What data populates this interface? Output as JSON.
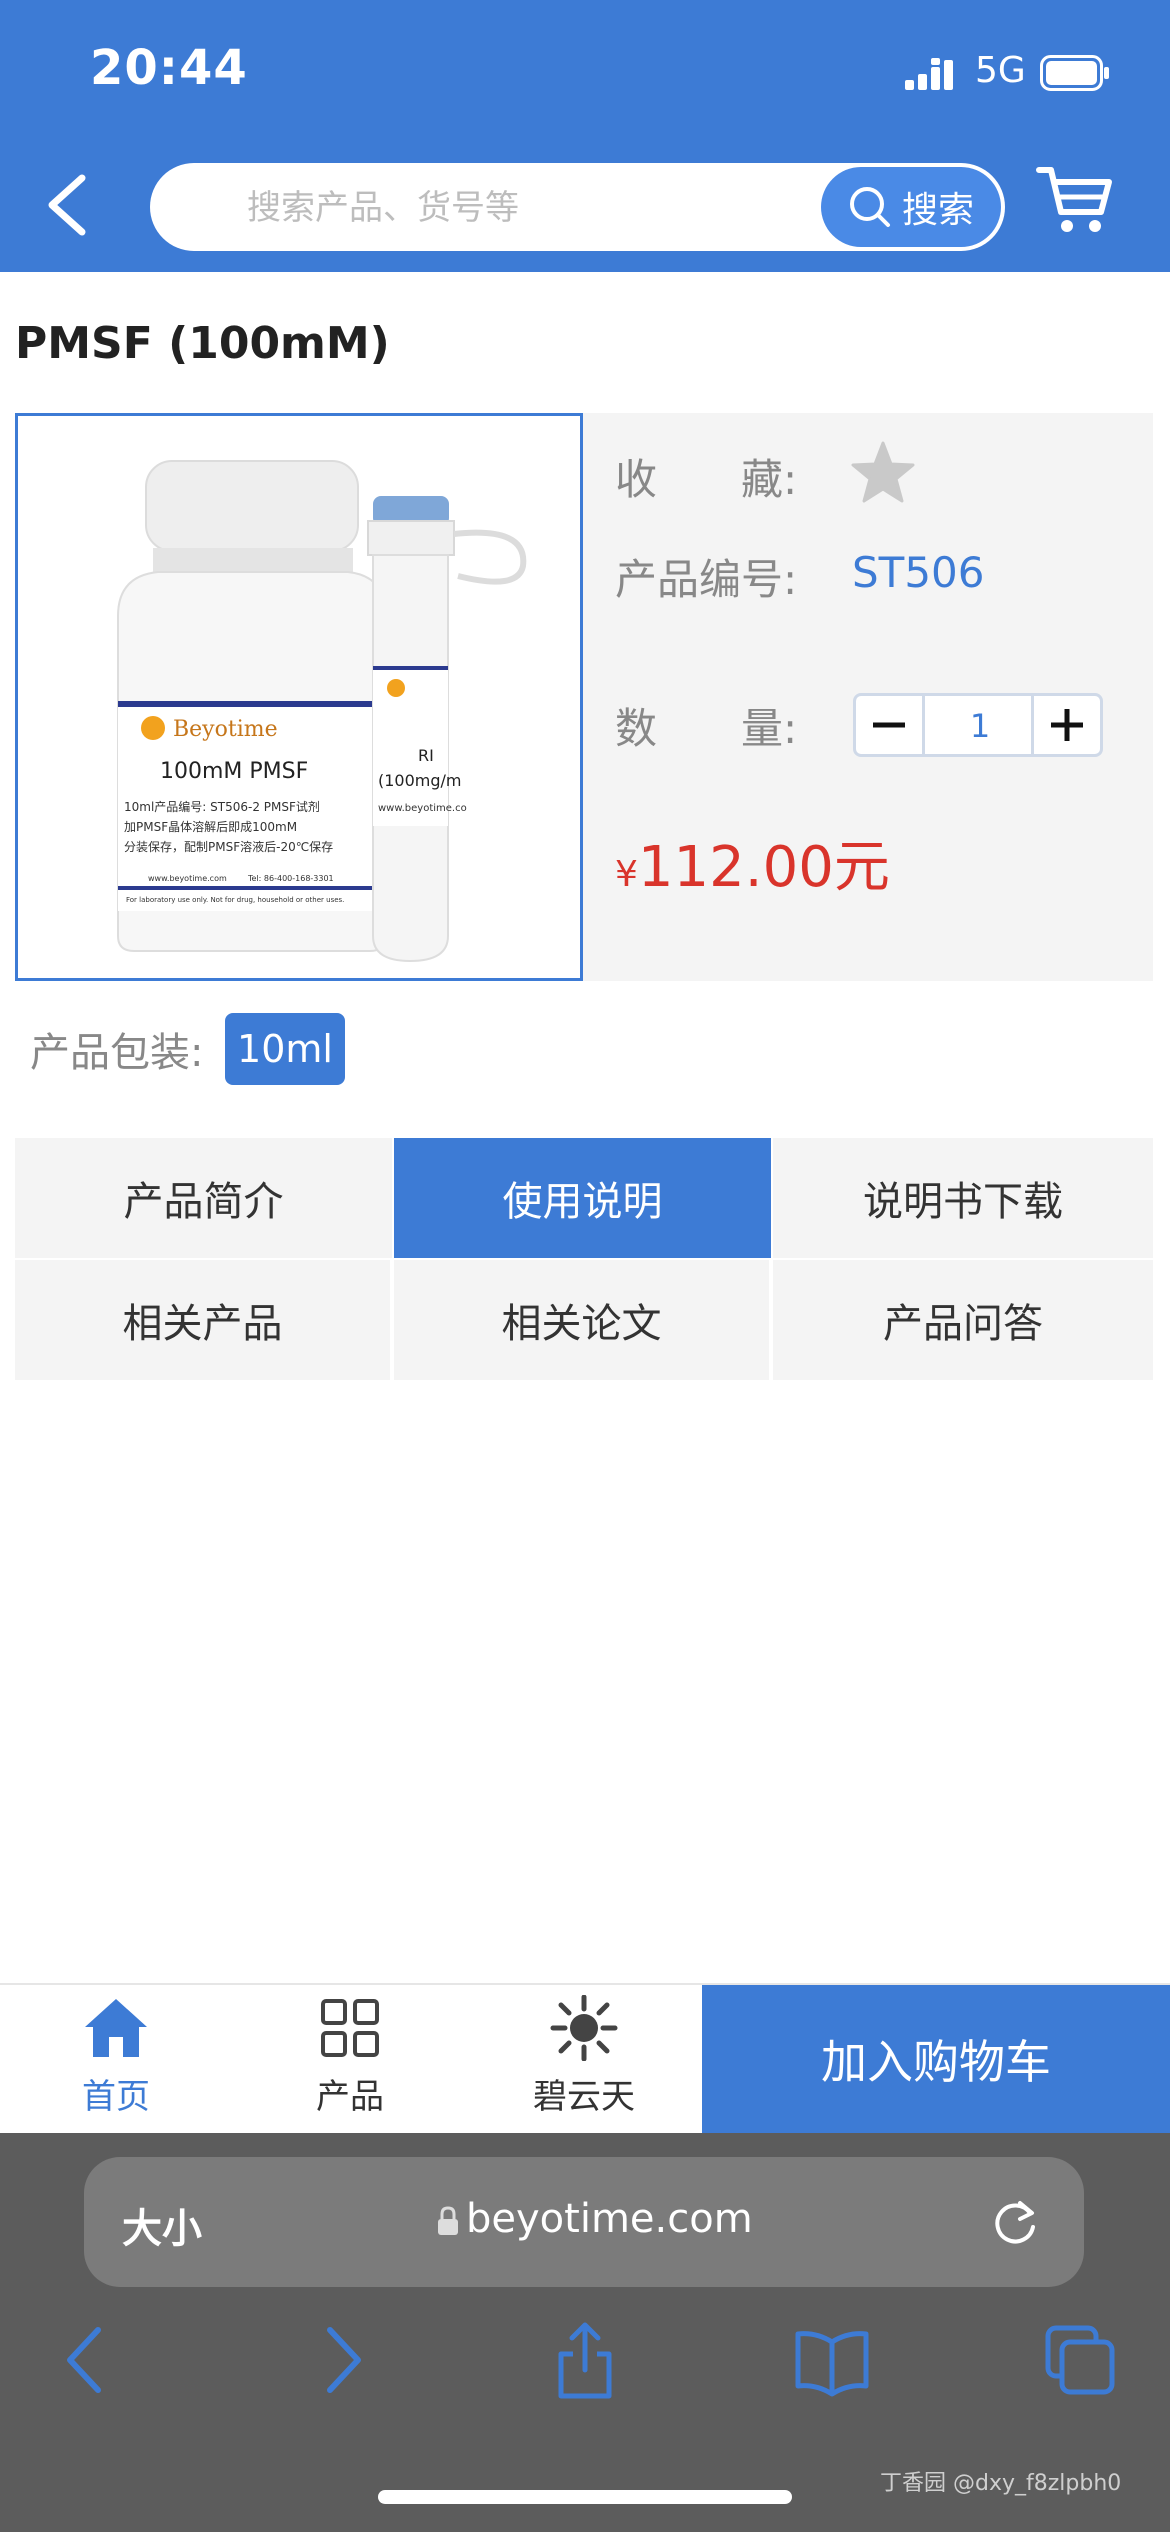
{
  "status_bar": {
    "time": "20:44",
    "network": "5G"
  },
  "header": {
    "search_placeholder": "搜索产品、货号等",
    "search_button_label": "搜索"
  },
  "product": {
    "title": "PMSF (100mM)",
    "favorite_label": "收　　藏:",
    "code_label": "产品编号:",
    "code_value": "ST506",
    "quantity_label": "数　　量:",
    "quantity_value": "1",
    "price_currency": "¥",
    "price_amount": "112.00元",
    "package_label": "产品包装:",
    "package_option": "10ml"
  },
  "image_text": {
    "brand": "Beyotime",
    "name": "100mM PMSF",
    "line1": "10ml产品编号: ST506-2 PMSF试剂",
    "line2": "加PMSF晶体溶解后即成100mM",
    "line3": "分装保存，配制PMSF溶液后-20℃保存",
    "site": "www.beyotime.com",
    "tel": "Tel: 86-400-168-3301",
    "disclaimer": "For laboratory use only. Not for drug, household or other uses.",
    "tube_line1": "RI",
    "tube_line2": "(100mg/m",
    "tube_site": "www.beyotime.co"
  },
  "tabs": [
    {
      "label": "产品简介",
      "active": false
    },
    {
      "label": "使用说明",
      "active": true
    },
    {
      "label": "说明书下载",
      "active": false
    },
    {
      "label": "相关产品",
      "active": false
    },
    {
      "label": "相关论文",
      "active": false
    },
    {
      "label": "产品问答",
      "active": false
    }
  ],
  "bottom_nav": {
    "home": "首页",
    "products": "产品",
    "brand": "碧云天",
    "add_to_cart": "加入购物车"
  },
  "browser": {
    "text_size": "大小",
    "url": "beyotime.com",
    "watermark": "丁香园 @dxy_f8zlpbh0"
  },
  "colors": {
    "primary": "#3d7bd5",
    "price": "#d9342b",
    "browser_bg": "#5c5c5c"
  }
}
